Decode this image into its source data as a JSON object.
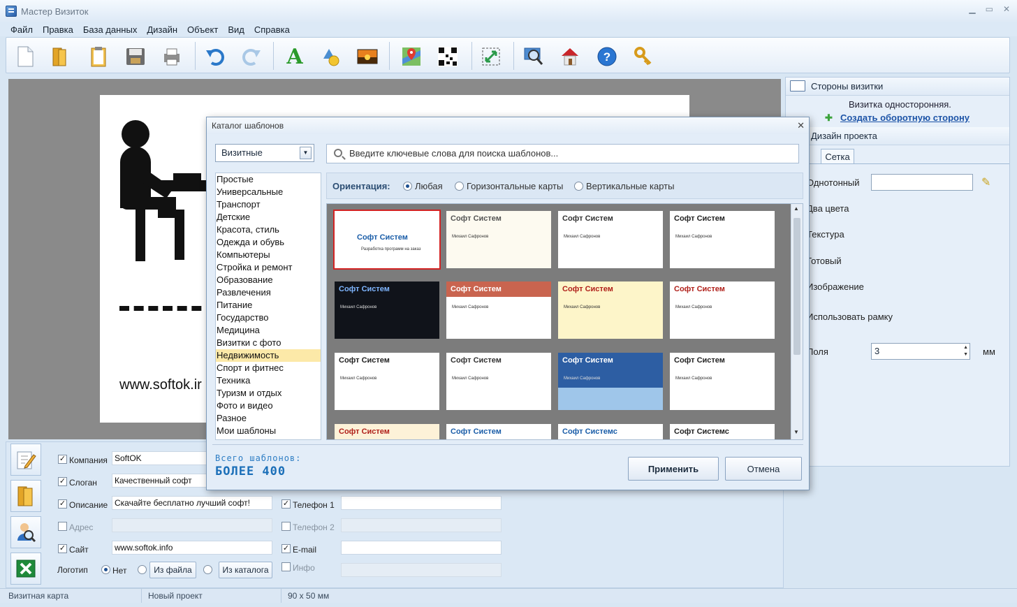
{
  "window": {
    "title": "Мастер Визиток"
  },
  "menu": [
    "Файл",
    "Правка",
    "База данных",
    "Дизайн",
    "Объект",
    "Вид",
    "Справка"
  ],
  "toolbar": {
    "icons": [
      "new-file-icon",
      "open-folder-icon",
      "clipboard-icon",
      "save-icon",
      "print-icon",
      "undo-icon",
      "redo-icon",
      "text-icon",
      "shapes-icon",
      "image-icon",
      "map-icon",
      "qr-code-icon",
      "fit-icon",
      "zoom-icon",
      "home-icon",
      "help-icon",
      "key-icon"
    ]
  },
  "canvas": {
    "site": "www.softok.ir"
  },
  "right_panel": {
    "sides_title": "Стороны визитки",
    "sides_status": "Визитка односторонняя.",
    "create_back_link": "Создать оборотную сторону",
    "design_title": "Дизайн проекта",
    "grid_tab": "Сетка",
    "rows": [
      "Однотонный",
      "Два цвета",
      "Текстура",
      "Готовый",
      "Изображение",
      "Использовать рамку",
      "Поля"
    ],
    "margin_value": "3",
    "margin_unit": "мм"
  },
  "form": {
    "company_label": "Компания",
    "company_value": "SoftOK",
    "slogan_label": "Слоган",
    "slogan_value": "Качественный софт",
    "desc_label": "Описание",
    "desc_value": "Скачайте бесплатно лучший софт!",
    "address_label": "Адрес",
    "site_label": "Сайт",
    "site_value": "www.softok.info",
    "logo_label": "Логотип",
    "logo_none": "Нет",
    "logo_file": "Из файла",
    "logo_catalog": "Из каталога",
    "phone1_label": "Телефон 1",
    "phone2_label": "Телефон 2",
    "email_label": "E-mail",
    "info_label": "Инфо"
  },
  "status": {
    "left": "Визитная карта",
    "project": "Новый проект",
    "size": "90 x 50 мм"
  },
  "dialog": {
    "title": "Каталог шаблонов",
    "close": "✕",
    "category_select": "Визитные",
    "search_placeholder": "Введите ключевые слова для поиска шаблонов...",
    "categories": [
      "Простые",
      "Универсальные",
      "Транспорт",
      "Детские",
      "Красота, стиль",
      "Одежда и обувь",
      "Компьютеры",
      "Стройка и ремонт",
      "Образование",
      "Развлечения",
      "Питание",
      "Государство",
      "Медицина",
      "Визитки с фото",
      "Недвижимость",
      "Спорт и фитнес",
      "Техника",
      "Туризм и отдых",
      "Фото и видео",
      "Разное",
      "Мои шаблоны"
    ],
    "selected_category": "Недвижимость",
    "orientation_label": "Ориентация:",
    "orientation_options": [
      "Любая",
      "Горизонтальные карты",
      "Вертикальные карты"
    ],
    "templates": [
      {
        "title": "Софт Систем",
        "sub": "Разработка программ на заказ",
        "bg": "#ffffff",
        "fg": "#1a5da8"
      },
      {
        "title": "Софт Систем",
        "sub": "Михаил Сафронов",
        "bg": "#fdfaf0",
        "fg": "#555555"
      },
      {
        "title": "Софт Систем",
        "sub": "Михаил Сафронов",
        "bg": "#ffffff",
        "fg": "#333333"
      },
      {
        "title": "Софт Систем",
        "sub": "Михаил Сафронов",
        "bg": "#ffffff",
        "fg": "#222222"
      },
      {
        "title": "Софт Систем",
        "sub": "Михаил Сафронов",
        "bg": "#10131a",
        "fg": "#7fb6ff"
      },
      {
        "title": "Софт Систем",
        "sub": "Михаил Сафронов",
        "bg": "#ffffff",
        "fg": "#ffffff"
      },
      {
        "title": "Софт Систем",
        "sub": "Михаил Сафронов",
        "bg": "#fdf5c9",
        "fg": "#b0201a"
      },
      {
        "title": "Софт Систем",
        "sub": "Михаил Сафронов",
        "bg": "#ffffff",
        "fg": "#b0201a"
      },
      {
        "title": "Софт Систем",
        "sub": "Михаил Сафронов",
        "bg": "#ffffff",
        "fg": "#222222"
      },
      {
        "title": "Софт Систем",
        "sub": "Михаил Сафронов",
        "bg": "#ffffff",
        "fg": "#333333"
      },
      {
        "title": "Софт Систем",
        "sub": "Михаил Сафронов",
        "bg": "#2d5ea3",
        "fg": "#ffffff"
      },
      {
        "title": "Софт Систем",
        "sub": "Михаил Сафронов",
        "bg": "#ffffff",
        "fg": "#222222"
      },
      {
        "title": "Софт Систем",
        "sub": "",
        "bg": "#fdf2d8",
        "fg": "#b0201a"
      },
      {
        "title": "Софт Систем",
        "sub": "",
        "bg": "#ffffff",
        "fg": "#1a5da8"
      },
      {
        "title": "Софт Системс",
        "sub": "",
        "bg": "#ffffff",
        "fg": "#1a5da8"
      },
      {
        "title": "Софт Системс",
        "sub": "",
        "bg": "#ffffff",
        "fg": "#222222"
      }
    ],
    "total_label": "Всего шаблонов:",
    "total_value": "более 400",
    "apply": "Применить",
    "cancel": "Отмена"
  }
}
